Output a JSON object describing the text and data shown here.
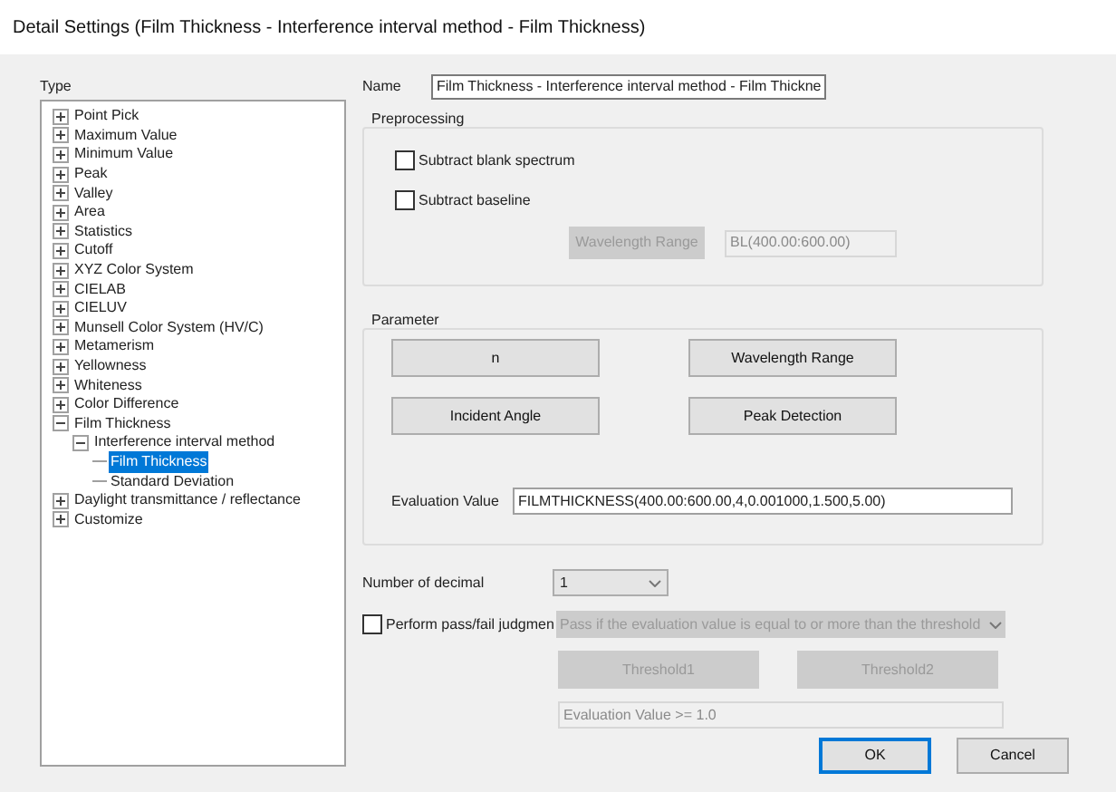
{
  "window": {
    "title": "Detail Settings (Film Thickness - Interference interval method - Film Thickness)"
  },
  "type_panel": {
    "label": "Type",
    "tree": [
      {
        "label": "Point Pick",
        "expanded": false,
        "selected": false
      },
      {
        "label": "Maximum Value",
        "expanded": false,
        "selected": false
      },
      {
        "label": "Minimum Value",
        "expanded": false,
        "selected": false
      },
      {
        "label": "Peak",
        "expanded": false,
        "selected": false
      },
      {
        "label": "Valley",
        "expanded": false,
        "selected": false
      },
      {
        "label": "Area",
        "expanded": false,
        "selected": false
      },
      {
        "label": "Statistics",
        "expanded": false,
        "selected": false
      },
      {
        "label": "Cutoff",
        "expanded": false,
        "selected": false
      },
      {
        "label": "XYZ Color System",
        "expanded": false,
        "selected": false
      },
      {
        "label": "CIELAB",
        "expanded": false,
        "selected": false
      },
      {
        "label": "CIELUV",
        "expanded": false,
        "selected": false
      },
      {
        "label": "Munsell Color System (HV/C)",
        "expanded": false,
        "selected": false
      },
      {
        "label": "Metamerism",
        "expanded": false,
        "selected": false
      },
      {
        "label": "Yellowness",
        "expanded": false,
        "selected": false
      },
      {
        "label": "Whiteness",
        "expanded": false,
        "selected": false
      },
      {
        "label": "Color Difference",
        "expanded": false,
        "selected": false
      },
      {
        "label": "Film Thickness",
        "expanded": true,
        "selected": false,
        "children": [
          {
            "label": "Interference interval method",
            "expanded": true,
            "selected": false,
            "children": [
              {
                "label": "Film Thickness",
                "selected": true
              },
              {
                "label": "Standard Deviation",
                "selected": false
              }
            ]
          }
        ]
      },
      {
        "label": "Daylight transmittance / reflectance",
        "expanded": false,
        "selected": false
      },
      {
        "label": "Customize",
        "expanded": false,
        "selected": false
      }
    ]
  },
  "name": {
    "label": "Name",
    "value": "Film Thickness - Interference interval method - Film Thickne"
  },
  "preprocessing": {
    "title": "Preprocessing",
    "checkboxes": [
      {
        "label": "Subtract blank spectrum",
        "checked": false
      },
      {
        "label": "Subtract baseline",
        "checked": false
      }
    ],
    "range_button": {
      "label": "Wavelength Range",
      "disabled": true
    },
    "range_field": {
      "value": "BL(400.00:600.00)",
      "disabled": true
    }
  },
  "parameter": {
    "title": "Parameter",
    "buttons": [
      {
        "label": "n"
      },
      {
        "label": "Wavelength Range"
      },
      {
        "label": "Incident Angle"
      },
      {
        "label": "Peak Detection"
      }
    ],
    "evaluation": {
      "label": "Evaluation Value",
      "value": "FILMTHICKNESS(400.00:600.00,4,0.001000,1.500,5.00)"
    }
  },
  "decimal": {
    "label": "Number of decimal",
    "value": "1"
  },
  "judgment": {
    "label": "Perform pass/fail judgmen",
    "checked": false,
    "condition": {
      "value": "Pass if the evaluation value is equal to or more than the threshold",
      "disabled": true
    },
    "thresholds": [
      {
        "label": "Threshold1",
        "disabled": true
      },
      {
        "label": "Threshold2",
        "disabled": true
      }
    ],
    "expression": {
      "value": "Evaluation Value >= 1.0",
      "disabled": true
    }
  },
  "buttons": [
    {
      "label": "OK",
      "default": true
    },
    {
      "label": "Cancel",
      "default": false
    }
  ]
}
